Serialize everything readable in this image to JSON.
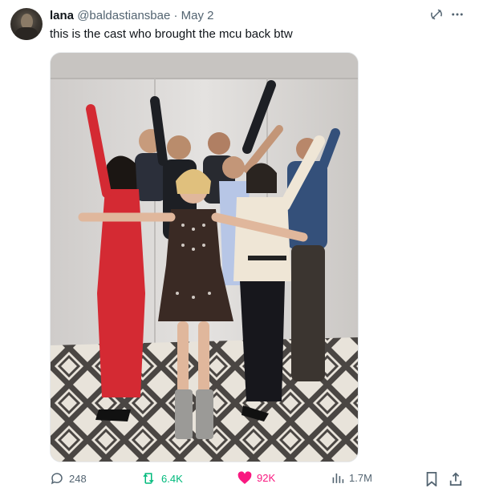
{
  "tweet": {
    "author_name": "lana",
    "author_handle": "@baldastiansbae",
    "separator": "·",
    "date": "May 2",
    "text": "this is the cast who brought the mcu back btw",
    "media_alt": "cast photo"
  },
  "actions": {
    "replies": "248",
    "retweets": "6.4K",
    "likes": "92K",
    "views": "1.7M"
  },
  "colors": {
    "retweet": "#00ba7c",
    "like": "#f91880",
    "muted": "#536471"
  },
  "icons": [
    "grok-icon",
    "more-icon",
    "reply-icon",
    "retweet-icon",
    "heart-icon",
    "views-icon",
    "bookmark-icon",
    "share-icon"
  ]
}
